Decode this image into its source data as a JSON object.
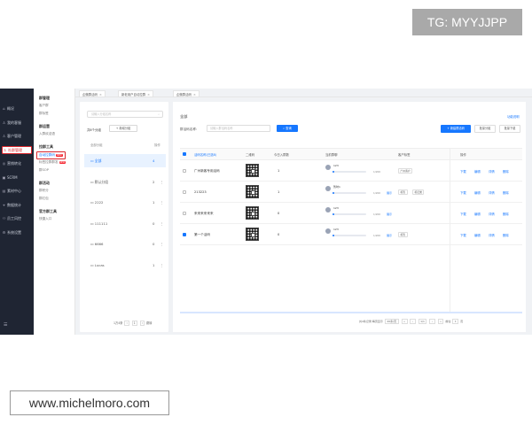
{
  "watermarks": {
    "top": "TG: MYYJJPP",
    "bottom": "www.michelmoro.com"
  },
  "sidebar": {
    "items": [
      {
        "icon": "home-icon",
        "glyph": "⌂",
        "label": "概况"
      },
      {
        "icon": "user-icon",
        "glyph": "♙",
        "label": "我的客服"
      },
      {
        "icon": "users-icon",
        "glyph": "♙",
        "label": "客户管理"
      },
      {
        "icon": "group-icon",
        "glyph": "♙",
        "label": "社群管理",
        "active": true
      },
      {
        "icon": "marketing-icon",
        "glyph": "◎",
        "label": "营销转化"
      },
      {
        "icon": "scrm-icon",
        "glyph": "▣",
        "label": "SCRM"
      },
      {
        "icon": "material-icon",
        "glyph": "▤",
        "label": "素材中心"
      },
      {
        "icon": "data-icon",
        "glyph": "⌖",
        "label": "数据统计"
      },
      {
        "icon": "staff-icon",
        "glyph": "⚇",
        "label": "员工风控"
      },
      {
        "icon": "settings-icon",
        "glyph": "⚙",
        "label": "系统设置"
      }
    ],
    "bottom_icon": "menu-icon"
  },
  "subnav": {
    "sections": [
      {
        "title": "群管理",
        "items": [
          "客户群",
          "群标签"
        ]
      },
      {
        "title": "群运营",
        "items": [
          "入群欢迎语"
        ]
      },
      {
        "title": "拉群工具",
        "items": [
          {
            "label": "自动拉群码",
            "tag": "NEW",
            "active": true
          },
          {
            "label": "标签拉群群发",
            "tag": "NEW"
          },
          {
            "label": "群SOP"
          }
        ]
      },
      {
        "title": "群活动",
        "items": [
          "群积分",
          "群红包"
        ]
      },
      {
        "title": "官方群工具",
        "items": [
          "快捷入口"
        ]
      }
    ]
  },
  "tabs": [
    {
      "label": "企微群活码"
    },
    {
      "label": "新老用户自动拉群"
    },
    {
      "label": "企微群活码"
    }
  ],
  "groups": {
    "search_placeholder": "请输入分组名称",
    "count_label": "共6个分组",
    "add_label": "+ 新增分组",
    "header_name": "全部分组",
    "header_action": "操作",
    "rows": [
      {
        "name": "全部",
        "count": "4",
        "active": true
      },
      {
        "name": "默认分组",
        "count": "2"
      },
      {
        "name": "2222",
        "count": "1"
      },
      {
        "name": "111111",
        "count": "0"
      },
      {
        "name": "6666",
        "count": "0"
      },
      {
        "name": "Lucas",
        "count": "1"
      }
    ],
    "pager": {
      "total": "1万4条",
      "page": "1",
      "goto": "跳转"
    }
  },
  "main": {
    "title": "全部",
    "doc_link": "功能说明",
    "filter_label": "群活码名称:",
    "filter_placeholder": "请输入群活码名称",
    "query_label": "查询",
    "create_label": "+ 新建群活码",
    "batch_group_label": "批量分组",
    "batch_download_label": "批量下载",
    "columns": [
      "活码名称(已选8)",
      "二维码",
      "今日入群数",
      "当前群聊",
      "客户标签",
      "操作"
    ],
    "rows": [
      {
        "name": "广州新客专用活码",
        "today": "1",
        "group": "123",
        "frac": "1/200",
        "show": "",
        "tags": [
          "广州客户"
        ],
        "checked": false,
        "fill": 0.05
      },
      {
        "name": "213223",
        "today": "1",
        "group": "暂时1",
        "frac": "1/200",
        "show": "展示",
        "tags": [
          "标签",
          "标记类"
        ],
        "checked": false,
        "fill": 0.05
      },
      {
        "name": "来来来来来来",
        "today": "0",
        "group": "123",
        "frac": "1/200",
        "show": "展示",
        "tags": [],
        "checked": false,
        "fill": 0.05
      },
      {
        "name": "第一个活码",
        "today": "0",
        "group": "123",
        "frac": "1/200",
        "show": "展示",
        "tags": [
          "标签"
        ],
        "checked": true,
        "fill": 0.05
      }
    ],
    "ops": [
      "下载",
      "编辑",
      "详情",
      "删除"
    ],
    "footer": {
      "total": "共4条记录,每页显示",
      "per_page": "20条/页",
      "page": "1/1",
      "goto": "前往",
      "page_num": "1",
      "unit": "页"
    }
  }
}
